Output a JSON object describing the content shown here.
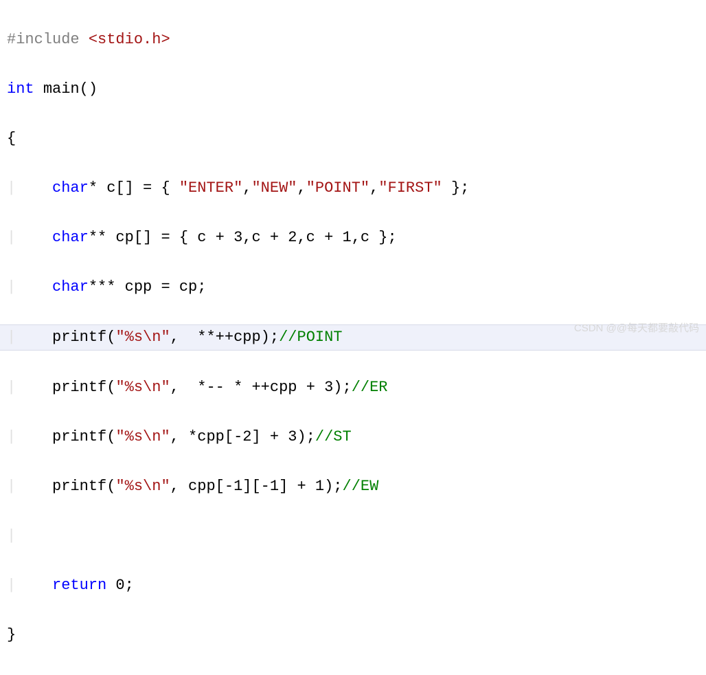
{
  "code": {
    "line1_preproc": "#include ",
    "line1_header": "<stdio.h>",
    "line2_kw1": "int",
    "line2_sp1": " ",
    "line2_ident": "main",
    "line2_paren": "()",
    "line3_brace": "{",
    "line4_indent": "    ",
    "line4_kw": "char",
    "line4_rest1": "* c[] = { ",
    "line4_s1": "\"ENTER\"",
    "line4_c1": ",",
    "line4_s2": "\"NEW\"",
    "line4_c2": ",",
    "line4_s3": "\"POINT\"",
    "line4_c3": ",",
    "line4_s4": "\"FIRST\"",
    "line4_end": " };",
    "line5_indent": "    ",
    "line5_kw": "char",
    "line5_rest": "** cp[] = { c + 3,c + 2,c + 1,c };",
    "line6_indent": "    ",
    "line6_kw": "char",
    "line6_rest": "*** cpp = cp;",
    "line7_indent": "    ",
    "line7_call": "printf(",
    "line7_s": "\"%s\\n\"",
    "line7_args": ",  **++cpp);",
    "line7_cm": "//POINT",
    "line8_indent": "    ",
    "line8_call": "printf(",
    "line8_s": "\"%s\\n\"",
    "line8_args": ",  *-- * ++cpp + 3);",
    "line8_cm": "//ER",
    "line9_indent": "    ",
    "line9_call": "printf(",
    "line9_s": "\"%s\\n\"",
    "line9_args": ", *cpp[-2] + 3);",
    "line9_cm": "//ST",
    "line10_indent": "    ",
    "line10_call": "printf(",
    "line10_s": "\"%s\\n\"",
    "line10_args": ", cpp[-1][-1] + 1);",
    "line10_cm": "//EW",
    "line12_indent": "    ",
    "line12_kw": "return",
    "line12_rest": " 0;",
    "line13_brace": "}"
  },
  "watermark": "CSDN @@每天都要敲代码",
  "guide": "|"
}
